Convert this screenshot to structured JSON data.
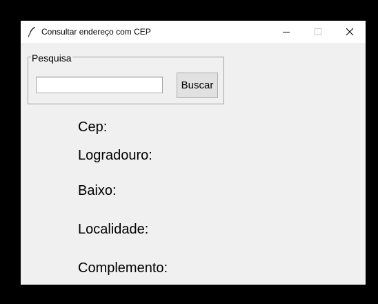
{
  "window": {
    "title": "Consultar endereço com CEP",
    "app_icon": "feather-icon",
    "controls": {
      "minimize_icon": "minimize-icon",
      "maximize_icon": "maximize-icon",
      "close_icon": "close-icon"
    }
  },
  "search": {
    "group_label": "Pesquisa",
    "input_value": "",
    "input_placeholder": "",
    "button_label": "Buscar"
  },
  "results": {
    "cep_label": "Cep:",
    "logradouro_label": "Logradouro:",
    "baixo_label": "Baixo:",
    "localidade_label": "Localidade:",
    "complemento_label": "Complemento:"
  },
  "colors": {
    "desktop_background": "#000000",
    "window_background": "#f0f0f0",
    "titlebar_background": "#ffffff",
    "button_background": "#e1e1e1"
  }
}
